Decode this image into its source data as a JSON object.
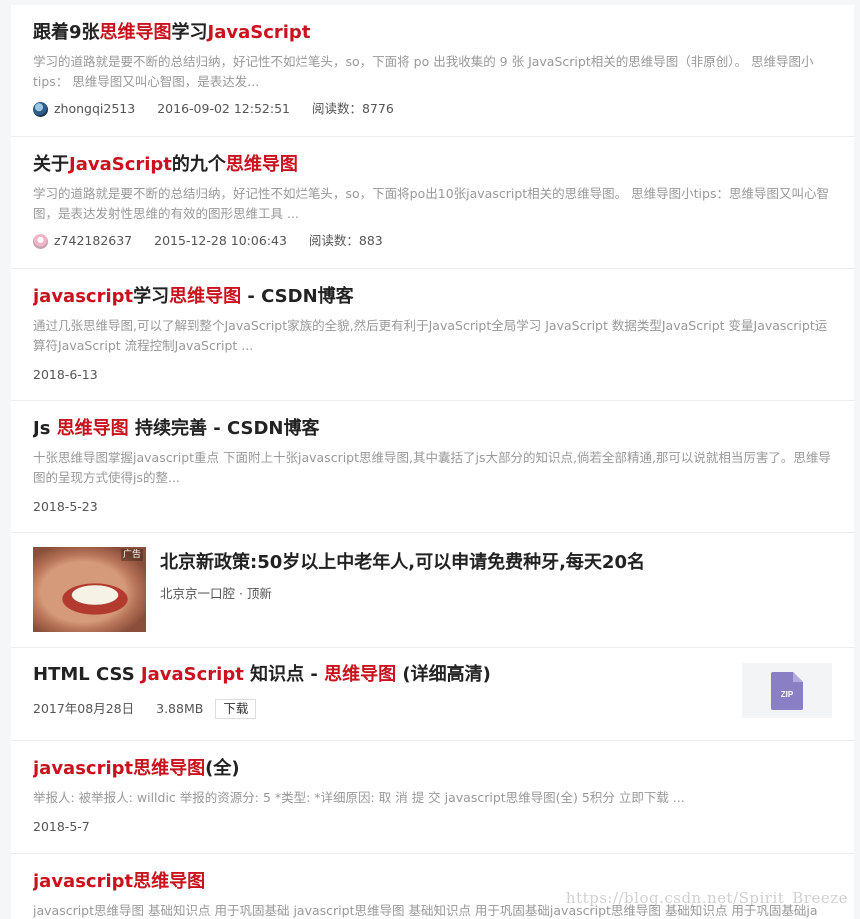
{
  "results": [
    {
      "title": [
        [
          "跟着9张",
          false
        ],
        [
          "思维导图",
          true
        ],
        [
          "学习",
          false
        ],
        [
          "JavaScript",
          true
        ]
      ],
      "desc": "学习的道路就是要不断的总结归纳，好记性不如烂笔头，so，下面将 po 出我收集的 9 张 JavaScript相关的思维导图（非原创）。 思维导图小tips： 思维导图又叫心智图，是表达发...",
      "author": "zhongqi2513",
      "date": "2016-09-02 12:52:51",
      "reads": "阅读数：8776"
    },
    {
      "title": [
        [
          "关于",
          false
        ],
        [
          "JavaScript",
          true
        ],
        [
          "的九个",
          false
        ],
        [
          "思维导图",
          true
        ]
      ],
      "desc": "学习的道路就是要不断的总结归纳，好记性不如烂笔头，so，下面将po出10张javascript相关的思维导图。 思维导图小tips：思维导图又叫心智图，是表达发射性思维的有效的图形思维工具 ...",
      "author": "z742182637",
      "date": "2015-12-28 10:06:43",
      "reads": "阅读数：883"
    },
    {
      "title": [
        [
          "javascript",
          true
        ],
        [
          "学习",
          false
        ],
        [
          "思维导图",
          true
        ],
        [
          " - CSDN博客",
          false
        ]
      ],
      "desc": "通过几张思维导图,可以了解到整个JavaScript家族的全貌,然后更有利于JavaScript全局学习 JavaScript 数据类型JavaScript 变量Javascript运算符JavaScript 流程控制JavaScript ...",
      "date": "2018-6-13"
    },
    {
      "title": [
        [
          "Js ",
          false
        ],
        [
          "思维导图",
          true
        ],
        [
          " 持续完善 - CSDN博客",
          false
        ]
      ],
      "desc": "十张思维导图掌握javascript重点 下面附上十张javascript思维导图,其中囊括了js大部分的知识点,倘若全部精通,那可以说就相当厉害了。思维导图的呈现方式使得js的整...",
      "date": "2018-5-23"
    }
  ],
  "ad": {
    "tag": "广告",
    "title": "北京新政策:50岁以上中老年人,可以申请免费种牙,每天20名",
    "source": "北京京一口腔 · 顶新"
  },
  "download": {
    "title": [
      [
        "HTML CSS ",
        false
      ],
      [
        "JavaScript",
        true
      ],
      [
        " 知识点 - ",
        false
      ],
      [
        "思维导图",
        true
      ],
      [
        " (详细高清)",
        false
      ]
    ],
    "date": "2017年08月28日",
    "size": "3.88MB",
    "button": "下载",
    "file_icon": "zip-file-icon",
    "file_label": "ZIP"
  },
  "results2": [
    {
      "title": [
        [
          "javascript思维导图",
          true
        ],
        [
          "(全)",
          false
        ]
      ],
      "desc": "举报人: 被举报人: willdic 举报的资源分: 5 *类型: *详细原因: 取  消  提  交 javascript思维导图(全) 5积分 立即下载 ...",
      "date": "2018-5-7"
    },
    {
      "title": [
        [
          "javascript思维导图",
          true
        ]
      ],
      "desc": "javascript思维导图 基础知识点 用于巩固基础 javascript思维导图 基础知识点 用于巩固基础javascript思维导图 基础知识点 用于巩固基础ja"
    }
  ],
  "watermark": "https://blog.csdn.net/Spirit_Breeze",
  "colors": {
    "highlight": "#c9121d",
    "zip_icon": "#8a7fc4"
  }
}
